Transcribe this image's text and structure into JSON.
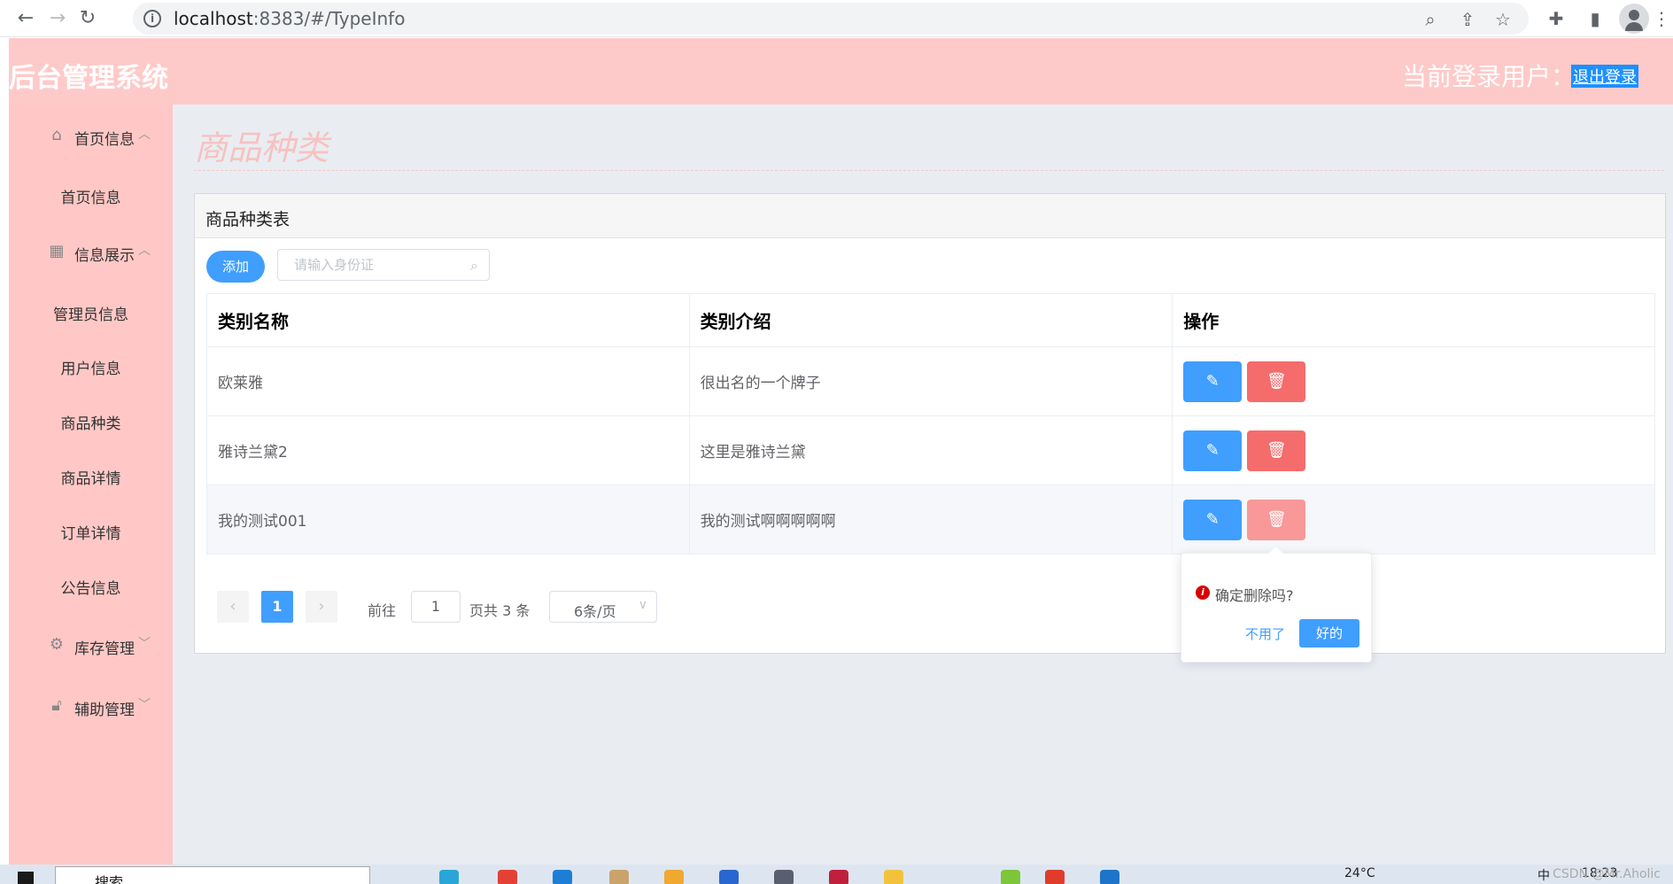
{
  "browser": {
    "url_host": "localhost",
    "url_rest": ":8383/#/TypeInfo"
  },
  "header": {
    "app_title": "后台管理系统",
    "login_label": "当前登录用户：",
    "logout_label": "退出登录"
  },
  "sidebar": {
    "groups": [
      {
        "label": "首页信息",
        "icon": "home-icon",
        "chevron": "︿",
        "items": [
          "首页信息"
        ]
      },
      {
        "label": "信息展示",
        "icon": "grid-icon",
        "chevron": "︿",
        "items": [
          "管理员信息",
          "用户信息",
          "商品种类",
          "商品详情",
          "订单详情",
          "公告信息"
        ]
      },
      {
        "label": "库存管理",
        "icon": "gear-icon",
        "chevron": "﹀",
        "items": []
      },
      {
        "label": "辅助管理",
        "icon": "lock-icon",
        "chevron": "﹀",
        "items": []
      }
    ]
  },
  "main": {
    "page_title": "商品种类",
    "card_title": "商品种类表",
    "add_label": "添加",
    "search_placeholder": "请输入身份证",
    "table": {
      "headers": [
        "类别名称",
        "类别介绍",
        "操作"
      ],
      "rows": [
        {
          "name": "欧莱雅",
          "desc": "很出名的一个牌子"
        },
        {
          "name": "雅诗兰黛2",
          "desc": "这里是雅诗兰黛"
        },
        {
          "name": "我的测试001",
          "desc": "我的测试啊啊啊啊啊"
        }
      ]
    },
    "pagination": {
      "prev": "‹",
      "current_page": "1",
      "next": "›",
      "goto_label": "前往",
      "goto_value": "1",
      "total_label": "页共 3 条",
      "page_size": "6条/页"
    }
  },
  "popconfirm": {
    "message": "确定删除吗?",
    "cancel_label": "不用了",
    "confirm_label": "好的"
  },
  "taskbar": {
    "search_text": "搜索",
    "weather": "24°C",
    "ime": "中",
    "time": "18:23",
    "watermark": "CSDN @Mr.Aholic"
  },
  "colors": {
    "header_bg": "#fecac9",
    "sidebar_bg": "#ffc8c6",
    "primary": "#409eff",
    "danger": "#f56c6c"
  }
}
